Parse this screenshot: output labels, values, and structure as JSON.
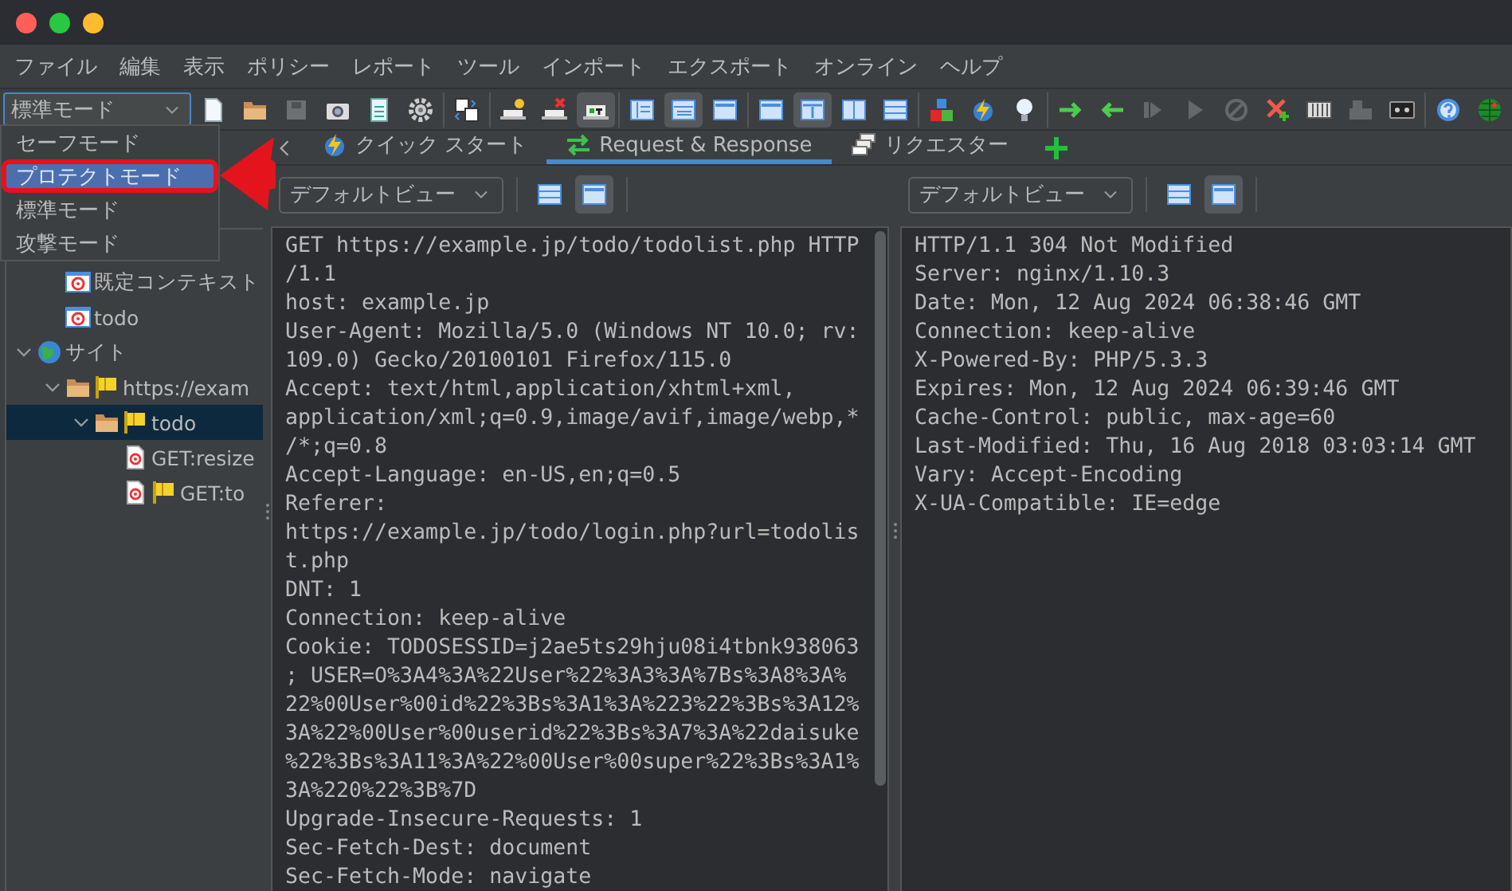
{
  "menu": [
    "ファイル",
    "編集",
    "表示",
    "ポリシー",
    "レポート",
    "ツール",
    "インポート",
    "エクスポート",
    "オンライン",
    "ヘルプ"
  ],
  "mode_select": {
    "value": "標準モード",
    "expanded": true,
    "options": [
      {
        "label": "セーフモード",
        "highlighted": false,
        "outlined": false
      },
      {
        "label": "プロテクトモード",
        "highlighted": true,
        "outlined": true
      },
      {
        "label": "標準モード",
        "highlighted": false,
        "outlined": false
      },
      {
        "label": "攻撃モード",
        "highlighted": false,
        "outlined": false
      }
    ]
  },
  "callout_arrow": {
    "kind": "arrow"
  },
  "toolbar": {
    "groups": [
      [
        {
          "kind": "page",
          "pressed": false,
          "disabled": false
        },
        {
          "kind": "folder",
          "pressed": false,
          "disabled": false
        },
        {
          "kind": "save",
          "pressed": false,
          "disabled": true
        },
        {
          "kind": "camera",
          "pressed": false,
          "disabled": false
        },
        {
          "kind": "sheet",
          "pressed": false,
          "disabled": false
        },
        {
          "kind": "gear",
          "pressed": false,
          "disabled": false
        }
      ],
      [
        {
          "kind": "compare",
          "pressed": false,
          "disabled": false
        }
      ],
      [
        {
          "kind": "laptop-bulb",
          "pressed": false,
          "disabled": false
        },
        {
          "kind": "laptop-x",
          "pressed": false,
          "disabled": false
        },
        {
          "kind": "laptop-t",
          "pressed": true,
          "disabled": false
        }
      ],
      [
        {
          "kind": "layout-side",
          "pressed": false,
          "disabled": false
        },
        {
          "kind": "layout-rows",
          "pressed": true,
          "disabled": false
        },
        {
          "kind": "window",
          "pressed": false,
          "disabled": false
        }
      ],
      [
        {
          "kind": "window",
          "pressed": false,
          "disabled": false
        },
        {
          "kind": "window-split",
          "pressed": true,
          "disabled": false
        },
        {
          "kind": "columns",
          "pressed": false,
          "disabled": false
        },
        {
          "kind": "rows",
          "pressed": false,
          "disabled": false
        }
      ],
      [
        {
          "kind": "blocks",
          "pressed": false,
          "disabled": false
        },
        {
          "kind": "lightning",
          "pressed": false,
          "disabled": false
        },
        {
          "kind": "bulb",
          "pressed": false,
          "disabled": false
        }
      ],
      [
        {
          "kind": "arrow-right",
          "pressed": false,
          "disabled": false
        },
        {
          "kind": "arrow-left",
          "pressed": false,
          "disabled": false
        },
        {
          "kind": "step",
          "pressed": false,
          "disabled": true
        },
        {
          "kind": "play",
          "pressed": false,
          "disabled": true
        },
        {
          "kind": "stop",
          "pressed": false,
          "disabled": true
        },
        {
          "kind": "x-plus",
          "pressed": false,
          "disabled": false
        },
        {
          "kind": "console",
          "pressed": false,
          "disabled": false
        },
        {
          "kind": "machine",
          "pressed": false,
          "disabled": true
        },
        {
          "kind": "tape",
          "pressed": false,
          "disabled": false
        }
      ],
      [
        {
          "kind": "help",
          "pressed": false,
          "disabled": false
        },
        {
          "kind": "globe",
          "pressed": false,
          "disabled": false
        }
      ]
    ]
  },
  "sites_tree": [
    {
      "kind": "contexts",
      "children": [
        {
          "kind": "context",
          "label": "既定コンテキスト",
          "selected": false
        },
        {
          "kind": "context",
          "label": "todo",
          "selected": false
        }
      ]
    },
    {
      "kind": "site-root",
      "label": "サイト",
      "expanded": true,
      "selected": false,
      "children": [
        {
          "kind": "folder",
          "label": "https://exam",
          "flagged": true,
          "expanded": true,
          "selected": false,
          "children": [
            {
              "kind": "folder",
              "label": "todo",
              "flagged": true,
              "expanded": true,
              "selected": true,
              "children": [
                {
                  "kind": "request",
                  "label": "GET:resize",
                  "flagged": false,
                  "selected": false
                },
                {
                  "kind": "request",
                  "label": "GET:to",
                  "flagged": true,
                  "selected": false
                }
              ]
            }
          ]
        }
      ]
    }
  ],
  "tabs": [
    {
      "kind": "lightning",
      "label": "クイック スタート",
      "selected": false
    },
    {
      "kind": "exchange",
      "label": "Request & Response",
      "selected": true
    },
    {
      "kind": "stack",
      "label": "リクエスター",
      "selected": false
    }
  ],
  "request": {
    "view": "デフォルトビュー",
    "layout_buttons": [
      {
        "pressed": false
      },
      {
        "pressed": true
      }
    ],
    "lines": [
      "GET https://example.jp/todo/todolist.php HTTP",
      "/1.1",
      "host: example.jp",
      "User-Agent: Mozilla/5.0 (Windows NT 10.0; rv:",
      "109.0) Gecko/20100101 Firefox/115.0",
      "Accept: text/html,application/xhtml+xml,",
      "application/xml;q=0.9,image/avif,image/webp,*",
      "/*;q=0.8",
      "Accept-Language: en-US,en;q=0.5",
      "Referer:",
      "https://example.jp/todo/login.php?url=todolis",
      "t.php",
      "DNT: 1",
      "Connection: keep-alive",
      "Cookie: TODOSESSID=j2ae5ts29hju08i4tbnk938063",
      "; USER=O%3A4%3A%22User%22%3A3%3A%7Bs%3A8%3A%",
      "22%00User%00id%22%3Bs%3A1%3A%223%22%3Bs%3A12%",
      "3A%22%00User%00userid%22%3Bs%3A7%3A%22daisuke",
      "%22%3Bs%3A11%3A%22%00User%00super%22%3Bs%3A1%",
      "3A%220%22%3B%7D",
      "Upgrade-Insecure-Requests: 1",
      "Sec-Fetch-Dest: document",
      "Sec-Fetch-Mode: navigate"
    ]
  },
  "response": {
    "view": "デフォルトビュー",
    "layout_buttons": [
      {
        "pressed": false
      },
      {
        "pressed": true
      }
    ],
    "lines": [
      "HTTP/1.1 304 Not Modified",
      "Server: nginx/1.10.3",
      "Date: Mon, 12 Aug 2024 06:38:46 GMT",
      "Connection: keep-alive",
      "X-Powered-By: PHP/5.3.3",
      "Expires: Mon, 12 Aug 2024 06:39:46 GMT",
      "Cache-Control: public, max-age=60",
      "Last-Modified: Thu, 16 Aug 2018 03:03:14 GMT",
      "Vary: Accept-Encoding",
      "X-UA-Compatible: IE=edge"
    ]
  }
}
